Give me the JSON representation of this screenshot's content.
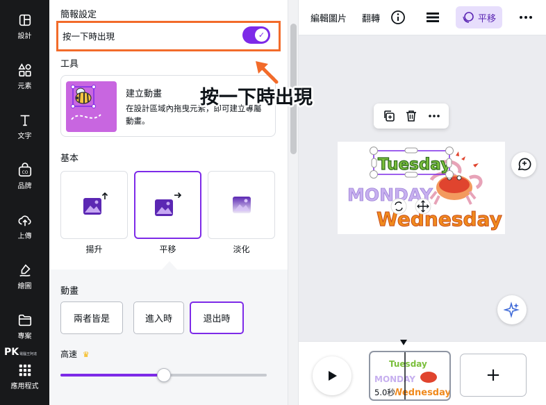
{
  "colors": {
    "accent": "#7d2ae8",
    "highlight": "#f26b2a",
    "rail": "#18191b"
  },
  "rail": {
    "items": [
      {
        "label": "設計",
        "icon": "layout-icon"
      },
      {
        "label": "元素",
        "icon": "shapes-icon"
      },
      {
        "label": "文字",
        "icon": "text-icon"
      },
      {
        "label": "品牌",
        "icon": "brand-icon"
      },
      {
        "label": "上傳",
        "icon": "upload-cloud-icon"
      },
      {
        "label": "繪圖",
        "icon": "draw-icon"
      },
      {
        "label": "專案",
        "icon": "folder-icon"
      },
      {
        "label": "應用程式",
        "icon": "apps-grid-icon"
      }
    ],
    "watermark": "PK",
    "watermark_small": "電腦王阿達"
  },
  "panel": {
    "presentation_title": "簡報設定",
    "toggle_label": "按一下時出現",
    "toggle_on": true,
    "tools_title": "工具",
    "tool": {
      "name": "建立動畫",
      "desc": "在設計區域內拖曳元素，即可建立專屬動畫。"
    },
    "basic_title": "基本",
    "animations": [
      {
        "label": "揚升",
        "selected": false
      },
      {
        "label": "平移",
        "selected": true
      },
      {
        "label": "淡化",
        "selected": false
      }
    ],
    "motion_title": "動畫",
    "motion_options": [
      {
        "label": "兩者皆是",
        "selected": false
      },
      {
        "label": "進入時",
        "selected": false
      },
      {
        "label": "退出時",
        "selected": true
      }
    ],
    "speed_label": "高速",
    "speed_value": 0.5
  },
  "topbar": {
    "edit_image": "編輯圖片",
    "flip": "翻轉",
    "active_animation": "平移"
  },
  "canvas": {
    "words": [
      "Tuesday",
      "MONDAY",
      "Wednesday"
    ]
  },
  "timeline": {
    "duration": "5.0秒",
    "add_page": "+"
  },
  "callout": {
    "text": "按一下時出現"
  }
}
